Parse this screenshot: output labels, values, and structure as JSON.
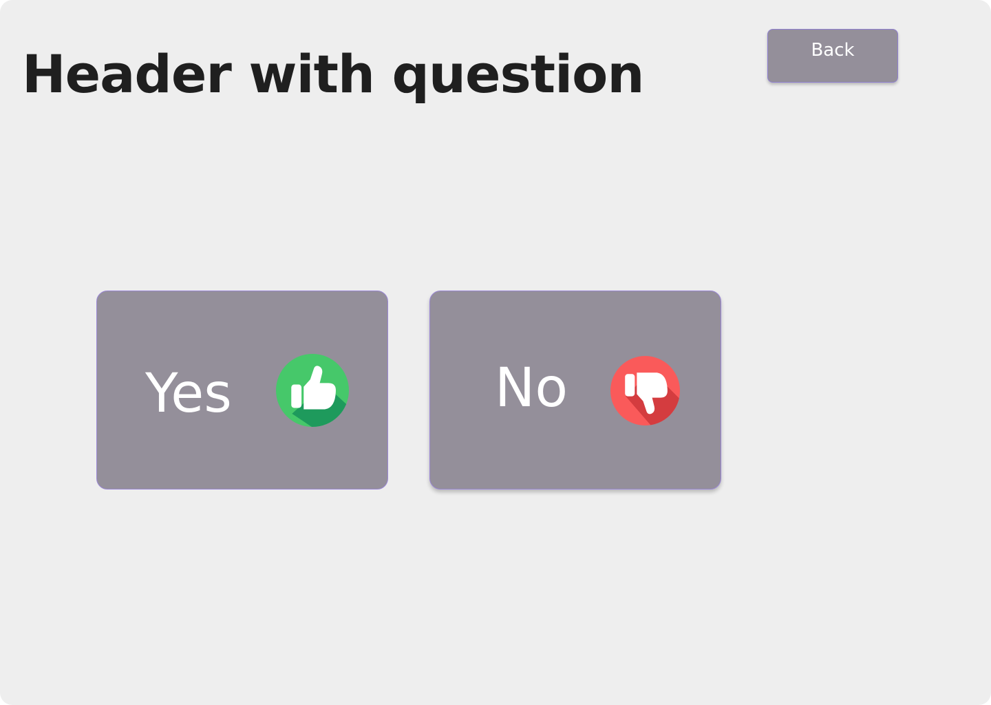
{
  "header": {
    "title": "Header with question"
  },
  "back_button": {
    "label": "Back"
  },
  "choices": [
    {
      "label": "Yes",
      "icon": "thumbs-up-icon",
      "icon_color": "#46c86a",
      "icon_shadow": "#1e9a5c"
    },
    {
      "label": "No",
      "icon": "thumbs-down-icon",
      "icon_color": "#fa5a5a",
      "icon_shadow": "#d43c3f"
    }
  ],
  "colors": {
    "background": "#eeeeee",
    "button_fill": "#948f9a",
    "button_border": "#9b87d6",
    "title_text": "#1f1f1f",
    "button_text": "#ffffff"
  }
}
